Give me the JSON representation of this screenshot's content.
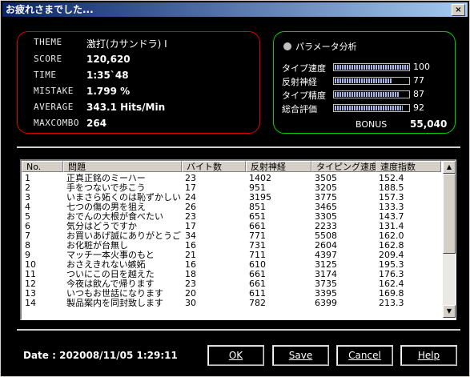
{
  "window": {
    "title": "お疲れさまでした...",
    "close_glyph": "×"
  },
  "stats": {
    "theme": {
      "label": "THEME",
      "value": "激打(カサンドラ) I"
    },
    "score": {
      "label": "SCORE",
      "value": "120,620"
    },
    "time": {
      "label": "TIME",
      "value": "1:35`48"
    },
    "mistake": {
      "label": "MISTAKE",
      "value": "1.799 %"
    },
    "average": {
      "label": "AVERAGE",
      "value": "343.1 Hits/Min"
    },
    "maxcombo": {
      "label": "MAXCOMBO",
      "value": "264"
    }
  },
  "params": {
    "title": "パラメータ分析",
    "items": [
      {
        "label": "タイプ速度",
        "value": "100",
        "level": 100
      },
      {
        "label": "反射神経",
        "value": "77",
        "level": 77
      },
      {
        "label": "タイプ精度",
        "value": "87",
        "level": 87
      },
      {
        "label": "総合評価",
        "value": "92",
        "level": 92
      }
    ],
    "bonus_label": "BONUS",
    "bonus_value": "55,040",
    "bar_color": "#a8b8e8"
  },
  "table": {
    "columns": [
      "No.",
      "問題",
      "バイト数",
      "反射神経",
      "タイピング速度",
      "速度指数"
    ],
    "rows": [
      [
        "1",
        "正真正銘のミーハー",
        "23",
        "1402",
        "3505",
        "152.4"
      ],
      [
        "2",
        "手をつないで歩こう",
        "17",
        "951",
        "3205",
        "188.5"
      ],
      [
        "3",
        "いまさら妬くのは恥ずかしい",
        "24",
        "3195",
        "3775",
        "157.3"
      ],
      [
        "4",
        "七つの傷の男を狙え",
        "26",
        "851",
        "3465",
        "133.3"
      ],
      [
        "5",
        "おでんの大根が食べたい",
        "23",
        "651",
        "3305",
        "143.7"
      ],
      [
        "6",
        "気分はどうですか",
        "17",
        "661",
        "2233",
        "131.4"
      ],
      [
        "7",
        "お買いあげ誠にありがとうご...",
        "34",
        "771",
        "5508",
        "162.0"
      ],
      [
        "8",
        "お化粧が台無し",
        "16",
        "731",
        "2604",
        "162.8"
      ],
      [
        "9",
        "マッチ一本火事のもと",
        "21",
        "711",
        "4397",
        "209.4"
      ],
      [
        "10",
        "おさえきれない嫉妬",
        "16",
        "610",
        "3125",
        "195.3"
      ],
      [
        "11",
        "ついにこの日を越えた",
        "18",
        "661",
        "3174",
        "176.3"
      ],
      [
        "12",
        "今夜は飲んで帰ります",
        "23",
        "661",
        "3735",
        "162.4"
      ],
      [
        "13",
        "いつもお世話になります",
        "20",
        "611",
        "3395",
        "169.8"
      ],
      [
        "14",
        "製品案内を同封致します",
        "30",
        "782",
        "6399",
        "213.3"
      ]
    ]
  },
  "footer": {
    "date": "Date : 202008/11/05 1:29:11",
    "ok_label": "OK",
    "save_label": "Save",
    "cancel_label": "Cancel",
    "help_label": "Help"
  },
  "colors": {
    "stats_border": "#e00000",
    "params_border": "#00d000",
    "title_start": "#0a246a",
    "title_end": "#a6caf0"
  }
}
